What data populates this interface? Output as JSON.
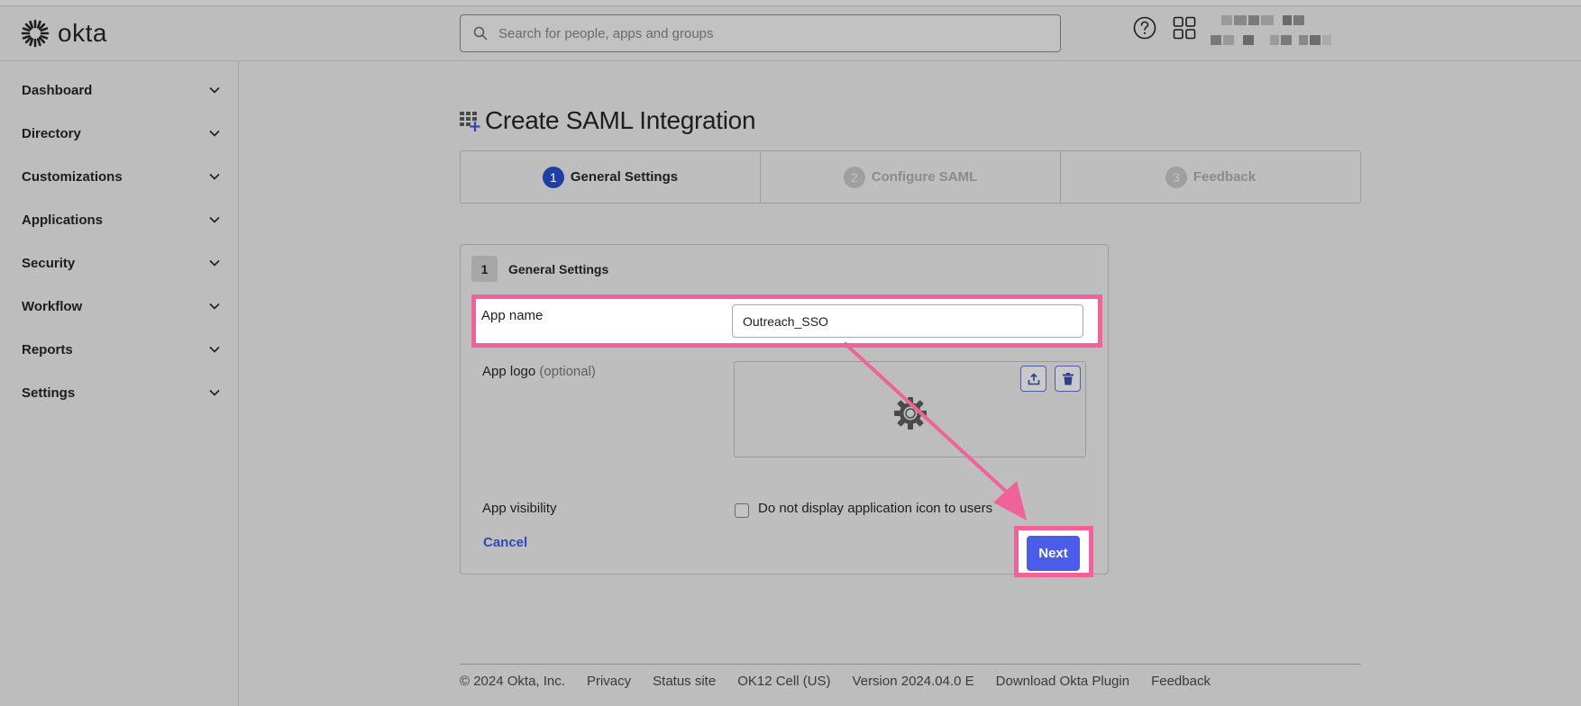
{
  "header": {
    "logo_text": "okta",
    "search_placeholder": "Search for people, apps and groups"
  },
  "sidebar": {
    "items": [
      {
        "label": "Dashboard"
      },
      {
        "label": "Directory"
      },
      {
        "label": "Customizations"
      },
      {
        "label": "Applications"
      },
      {
        "label": "Security"
      },
      {
        "label": "Workflow"
      },
      {
        "label": "Reports"
      },
      {
        "label": "Settings"
      }
    ]
  },
  "page": {
    "title": "Create SAML Integration"
  },
  "stepper": {
    "steps": [
      {
        "num": "1",
        "label": "General Settings",
        "state": "active"
      },
      {
        "num": "2",
        "label": "Configure SAML",
        "state": "inactive"
      },
      {
        "num": "3",
        "label": "Feedback",
        "state": "inactive"
      }
    ]
  },
  "form": {
    "section_num": "1",
    "section_title": "General Settings",
    "app_name_label": "App name",
    "app_name_value": "Outreach_SSO",
    "app_logo_label": "App logo",
    "app_logo_optional": "(optional)",
    "app_visibility_label": "App visibility",
    "visibility_checkbox_label": "Do not display application icon to users",
    "cancel_label": "Cancel",
    "next_label": "Next"
  },
  "footer": {
    "links": [
      "© 2024 Okta, Inc.",
      "Privacy",
      "Status site",
      "OK12 Cell (US)",
      "Version 2024.04.0 E",
      "Download Okta Plugin",
      "Feedback"
    ]
  },
  "colors": {
    "accent": "#1f3fa5",
    "button": "#4b5ce8",
    "highlight": "#f0639a",
    "link": "#3048b5"
  }
}
